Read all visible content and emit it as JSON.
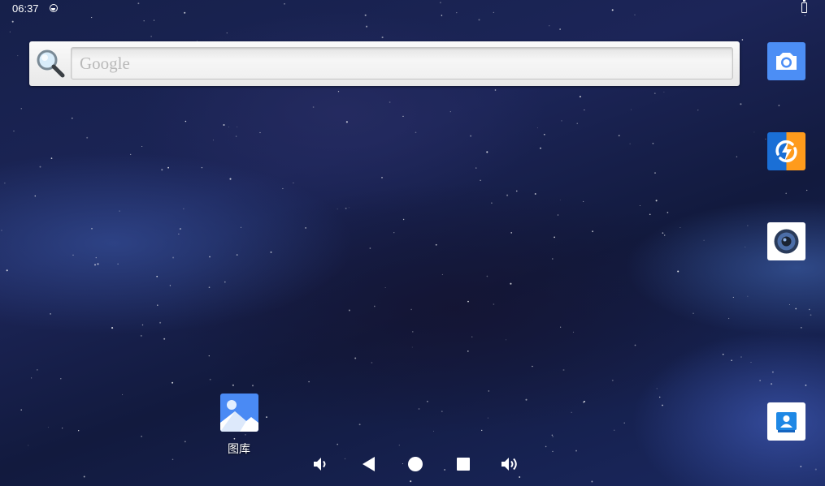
{
  "status_bar": {
    "time": "06:37",
    "notification_icon": "sync-circle-icon",
    "battery_icon": "battery-icon"
  },
  "search_widget": {
    "placeholder": "Google",
    "icon": "magnifier-icon"
  },
  "dock_apps": [
    {
      "name": "camera",
      "icon": "camera-icon",
      "color": "#4c8ef5"
    },
    {
      "name": "booster",
      "icon": "lightning-bolt-icon",
      "color": "#ff9b1c"
    },
    {
      "name": "speaker",
      "icon": "speaker-icon",
      "color": "#ffffff"
    },
    {
      "name": "contacts",
      "icon": "contacts-icon",
      "color": "#1e88e5"
    }
  ],
  "desktop_shortcuts": [
    {
      "label": "图库",
      "icon": "gallery-icon",
      "color": "#4a8af4"
    }
  ],
  "nav_bar": {
    "buttons": [
      "volume-down-icon",
      "back-icon",
      "home-icon",
      "recents-icon",
      "volume-up-icon"
    ]
  }
}
